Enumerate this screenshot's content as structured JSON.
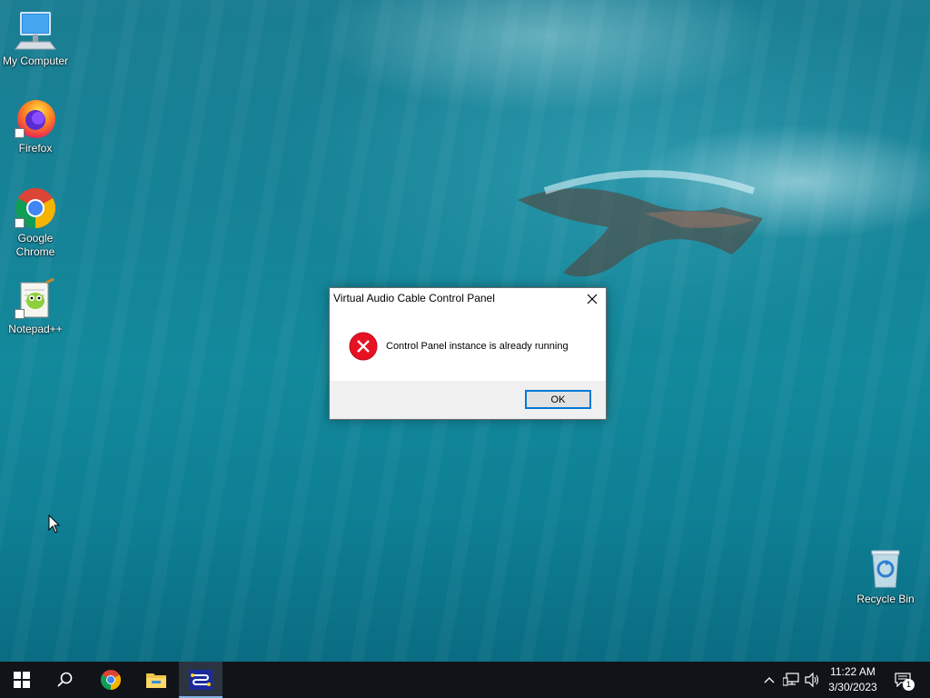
{
  "desktop": {
    "icons": [
      {
        "label": "My Computer",
        "icon": "computer-icon"
      },
      {
        "label": "Firefox",
        "icon": "firefox-icon"
      },
      {
        "label": "Google Chrome",
        "icon": "chrome-icon"
      },
      {
        "label": "Notepad++",
        "icon": "notepadpp-icon"
      },
      {
        "label": "Recycle Bin",
        "icon": "recycle-bin-icon"
      }
    ]
  },
  "dialog": {
    "title": "Virtual Audio Cable Control Panel",
    "message": "Control Panel instance is already running",
    "ok_label": "OK",
    "icon": "error-icon"
  },
  "taskbar": {
    "buttons": [
      "start-icon",
      "search-icon",
      "chrome-icon",
      "file-explorer-icon",
      "virtual-audio-cable-icon"
    ],
    "active_app": "Virtual Audio Cable Control Panel",
    "tray": [
      "chevron-up-icon",
      "network-icon",
      "volume-icon"
    ],
    "time": "11:22 AM",
    "date": "3/30/2023",
    "notification_count": "1"
  },
  "colors": {
    "accent": "#0078d7",
    "error": "#e81123",
    "taskbar": "#101418"
  }
}
